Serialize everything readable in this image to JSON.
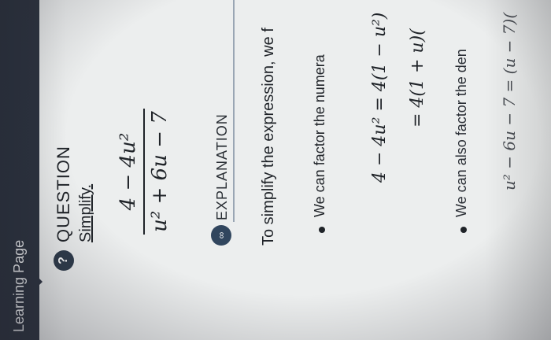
{
  "sidebar": {
    "title": "Learning Page"
  },
  "question": {
    "icon": "question-icon",
    "icon_glyph": "?",
    "title": "QUESTION",
    "prompt": "Simplify.",
    "numerator": "4 − 4u²",
    "denominator": "u² + 6u − 7"
  },
  "explanation": {
    "icon": "infinity-icon",
    "icon_glyph": "∞",
    "title": "EXPLANATION",
    "intro": "To simplify the expression, we f",
    "bullet1": "We can factor the numera",
    "step1": "4 − 4u² = 4(1 − u²)",
    "step2": "= 4(1 + u)(",
    "bullet2": "We can also factor the den",
    "step3": "u² − 6u − 7 = (u − 7)("
  },
  "colors": {
    "bar": "#2c3340",
    "accent": "#3d5b7a",
    "background": "#eceeee"
  }
}
